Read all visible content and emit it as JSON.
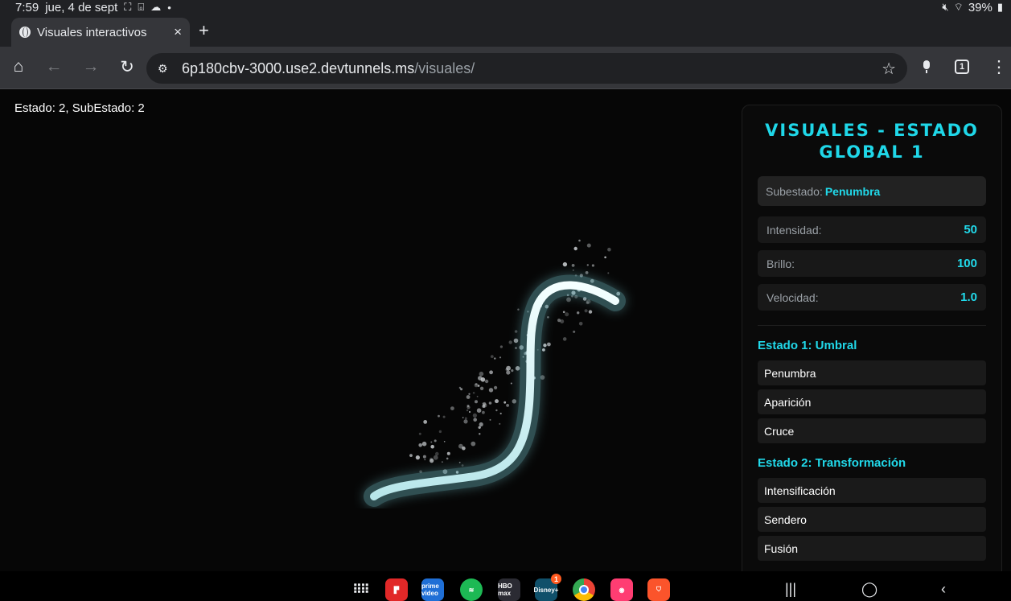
{
  "status_bar": {
    "time": "7:59",
    "date": "jue, 4 de sept",
    "battery": "39%"
  },
  "browser": {
    "tab_title": "Visuales interactivos",
    "tab_count": "1",
    "url_host": "6p180cbv-3000.use2.devtunnels.ms",
    "url_path": "/visuales/"
  },
  "page": {
    "status_text": "Estado: 2, SubEstado: 2",
    "panel": {
      "title": "VISUALES - ESTADO GLOBAL 1",
      "substate_label": "Subestado:",
      "substate_value": "Penumbra",
      "params": [
        {
          "label": "Intensidad:",
          "value": "50"
        },
        {
          "label": "Brillo:",
          "value": "100"
        },
        {
          "label": "Velocidad:",
          "value": "1.0"
        }
      ],
      "groups": [
        {
          "title": "Estado 1: Umbral",
          "options": [
            "Penumbra",
            "Aparición",
            "Cruce"
          ]
        },
        {
          "title": "Estado 2: Transformación",
          "options": [
            "Intensificación",
            "Sendero",
            "Fusión"
          ]
        }
      ]
    }
  },
  "taskbar": {
    "apps": [
      {
        "name": "apps-grid",
        "color": "#000000"
      },
      {
        "name": "flipboard",
        "color": "#e12828"
      },
      {
        "name": "prime-video",
        "color": "#1f6fd6",
        "label": "prime video"
      },
      {
        "name": "spotify",
        "color": "#1db954"
      },
      {
        "name": "hbo-max",
        "color": "#2b2b33",
        "label": "HBO max"
      },
      {
        "name": "disney-plus",
        "color": "#10506a",
        "label": "Disney+",
        "badge": "1"
      },
      {
        "name": "chrome",
        "color": "#ffffff"
      },
      {
        "name": "screen-recorder",
        "color": "#ff3d72"
      },
      {
        "name": "brave",
        "color": "#fb542b"
      }
    ]
  },
  "colors": {
    "accent": "#21d9ea",
    "background": "#060606"
  }
}
